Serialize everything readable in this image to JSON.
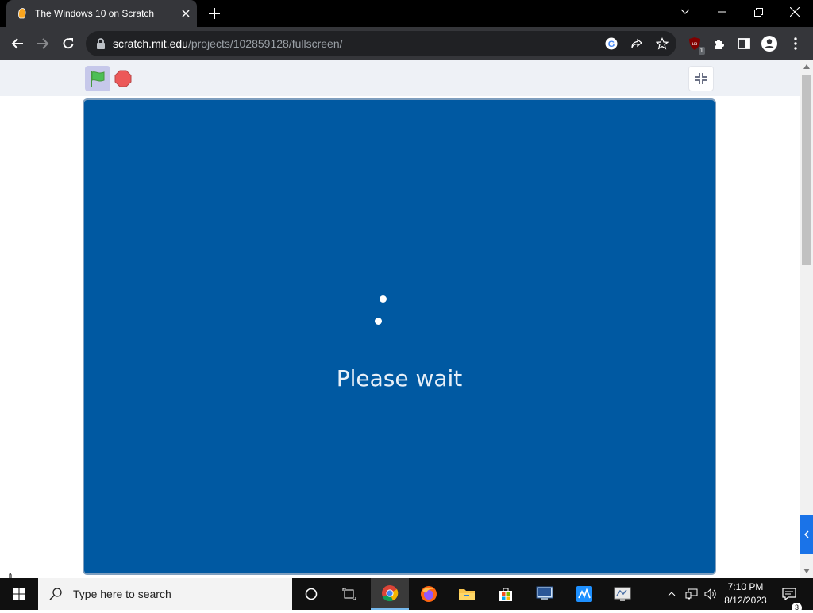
{
  "browser": {
    "tab_title": "The Windows 10 on Scratch",
    "url_host": "scratch.mit.edu",
    "url_path": "/projects/102859128/fullscreen/",
    "extension_badge": "1"
  },
  "stage": {
    "status_text": "Please wait",
    "background_color": "#0059a2"
  },
  "taskbar": {
    "search_placeholder": "Type here to search",
    "time": "7:10 PM",
    "date": "8/12/2023",
    "notification_count": "3"
  },
  "icons": [
    "scratch-favicon",
    "close-icon",
    "plus-icon",
    "chevron-down-icon",
    "minimize-icon",
    "restore-icon",
    "back-icon",
    "forward-icon",
    "reload-icon",
    "lock-icon",
    "google-icon",
    "share-icon",
    "star-icon",
    "puzzle-icon",
    "sidepanel-icon",
    "profile-icon",
    "menu-icon",
    "green-flag-icon",
    "stop-icon",
    "exit-fullscreen-icon",
    "windows-icon",
    "search-icon",
    "cortana-icon",
    "task-view-icon",
    "chrome-icon",
    "firefox-icon",
    "file-explorer-icon",
    "store-icon",
    "app-icon",
    "network-icon",
    "volume-icon",
    "notification-icon"
  ]
}
